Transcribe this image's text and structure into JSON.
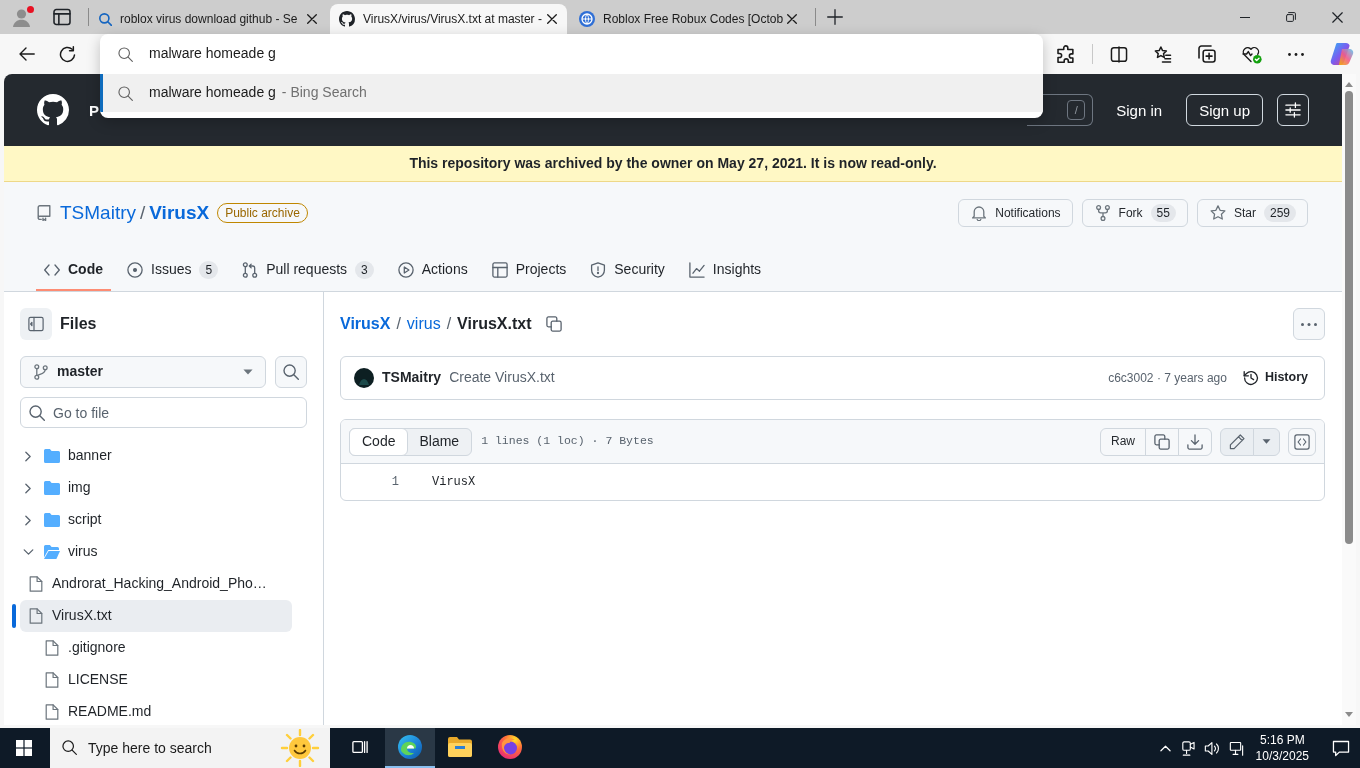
{
  "browser": {
    "tabs": [
      {
        "title": "roblox virus download github - Se",
        "kind": "search",
        "selected": false
      },
      {
        "title": "VirusX/virus/VirusX.txt at master -",
        "kind": "github",
        "selected": true
      },
      {
        "title": "Roblox Free Robux Codes [Octob",
        "kind": "site",
        "selected": false
      }
    ],
    "address_dropdown": {
      "query": "malware homeade g",
      "suggestions": [
        {
          "text": "malware homeade g",
          "source": "- Bing Search",
          "selected": true
        }
      ]
    }
  },
  "page": {
    "header": {
      "nav_partial": "P",
      "search_key": "/",
      "sign_in": "Sign in",
      "sign_up": "Sign up"
    },
    "archive_notice": "This repository was archived by the owner on May 27, 2021. It is now read-only.",
    "repo": {
      "owner": "TSMaitry",
      "separator": "/",
      "name": "VirusX",
      "visibility": "Public archive",
      "actions": [
        {
          "kind": "notifications",
          "label": "Notifications"
        },
        {
          "kind": "fork",
          "label": "Fork",
          "count": "55"
        },
        {
          "kind": "star",
          "label": "Star",
          "count": "259"
        }
      ]
    },
    "tabs": [
      {
        "kind": "code",
        "label": "Code",
        "selected": true
      },
      {
        "kind": "issues",
        "label": "Issues",
        "count": "5",
        "selected": false
      },
      {
        "kind": "pulls",
        "label": "Pull requests",
        "count": "3",
        "selected": false
      },
      {
        "kind": "actions",
        "label": "Actions",
        "selected": false
      },
      {
        "kind": "projects",
        "label": "Projects",
        "selected": false
      },
      {
        "kind": "security",
        "label": "Security",
        "selected": false
      },
      {
        "kind": "insights",
        "label": "Insights",
        "selected": false
      }
    ],
    "file_tree": {
      "title": "Files",
      "branch": "master",
      "search_placeholder": "Go to file",
      "items": [
        {
          "name": "banner",
          "kind": "folder",
          "expanded": false,
          "selected": false
        },
        {
          "name": "img",
          "kind": "folder",
          "expanded": false,
          "selected": false
        },
        {
          "name": "script",
          "kind": "folder",
          "expanded": false,
          "selected": false
        },
        {
          "name": "virus",
          "kind": "folder",
          "expanded": true,
          "selected": false,
          "children": [
            {
              "name": "Androrat_Hacking_Android_Pho…",
              "kind": "file",
              "selected": false
            },
            {
              "name": "VirusX.txt",
              "kind": "file",
              "selected": true
            }
          ]
        },
        {
          "name": ".gitignore",
          "kind": "file",
          "selected": false
        },
        {
          "name": "LICENSE",
          "kind": "file",
          "selected": false
        },
        {
          "name": "README.md",
          "kind": "file",
          "selected": false
        }
      ]
    },
    "breadcrumb": [
      {
        "text": "VirusX",
        "kind": "repo-link"
      },
      {
        "text": "/",
        "kind": "separator"
      },
      {
        "text": "virus",
        "kind": "link"
      },
      {
        "text": "/",
        "kind": "separator"
      },
      {
        "text": "VirusX.txt",
        "kind": "current"
      }
    ],
    "commit": {
      "author": "TSMaitry",
      "message": "Create VirusX.txt",
      "meta": "c6c3002 · 7 years ago",
      "history": "History"
    },
    "file_view": {
      "modes": [
        {
          "label": "Code",
          "selected": true
        },
        {
          "label": "Blame",
          "selected": false
        }
      ],
      "info": "1 lines (1 loc) · 7 Bytes",
      "raw": "Raw",
      "lines": [
        {
          "number": "1",
          "text": "VirusX"
        }
      ]
    }
  },
  "taskbar": {
    "search_placeholder": "Type here to search",
    "apps": [
      {
        "kind": "task-view",
        "active": false
      },
      {
        "kind": "edge",
        "active": true
      },
      {
        "kind": "file-explorer",
        "active": false
      },
      {
        "kind": "firefox",
        "active": false
      }
    ],
    "time": "5:16 PM",
    "date": "10/3/2025"
  }
}
